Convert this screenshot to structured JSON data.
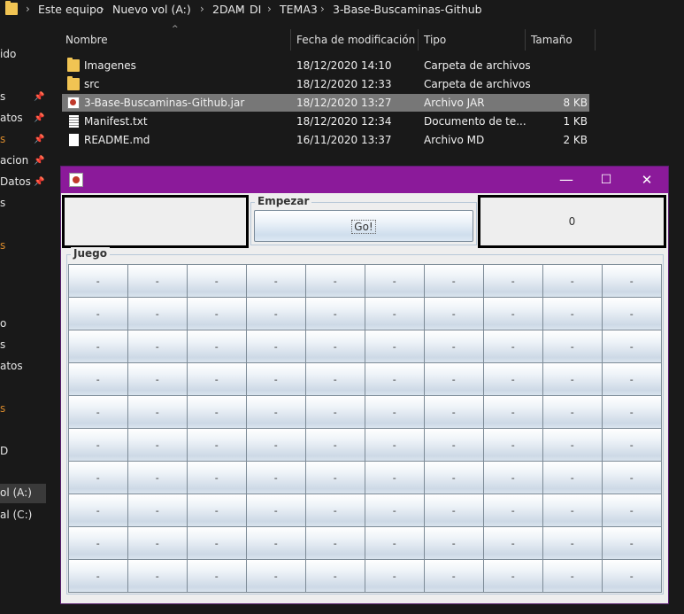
{
  "breadcrumb": [
    "Este equipo",
    "Nuevo vol (A:)",
    "2DAM",
    "DI",
    "TEMA3",
    "3-Base-Buscaminas-Github"
  ],
  "nav_pane": {
    "items": [
      {
        "label": "ido",
        "pinned": false
      },
      {
        "label": "s",
        "pinned": true
      },
      {
        "label": "atos",
        "pinned": true
      },
      {
        "label": "s",
        "pinned": true
      },
      {
        "label": "acion",
        "pinned": true
      },
      {
        "label": "Datos",
        "pinned": true
      },
      {
        "label": "s",
        "pinned": false
      },
      {
        "label": "s",
        "pinned": false
      },
      {
        "label": "o",
        "pinned": false
      },
      {
        "label": "s",
        "pinned": false
      },
      {
        "label": "atos",
        "pinned": false
      },
      {
        "label": "s",
        "pinned": false
      },
      {
        "label": "D",
        "pinned": false
      },
      {
        "label": "ol (A:)",
        "pinned": false,
        "selected": true
      },
      {
        "label": "al (C:)",
        "pinned": false
      }
    ]
  },
  "file_list": {
    "columns": [
      "Nombre",
      "Fecha de modificación",
      "Tipo",
      "Tamaño"
    ],
    "rows": [
      {
        "name": "Imagenes",
        "date": "18/12/2020 14:10",
        "type": "Carpeta de archivos",
        "size": "",
        "icon": "folder-icon"
      },
      {
        "name": "src",
        "date": "18/12/2020 12:33",
        "type": "Carpeta de archivos",
        "size": "",
        "icon": "folder-icon"
      },
      {
        "name": "3-Base-Buscaminas-Github.jar",
        "date": "18/12/2020 13:27",
        "type": "Archivo JAR",
        "size": "8 KB",
        "icon": "jar-file-icon",
        "selected": true
      },
      {
        "name": "Manifest.txt",
        "date": "18/12/2020 12:34",
        "type": "Documento de te...",
        "size": "1 KB",
        "icon": "text-file-icon"
      },
      {
        "name": "README.md",
        "date": "16/11/2020 13:37",
        "type": "Archivo MD",
        "size": "2 KB",
        "icon": "document-file-icon"
      }
    ]
  },
  "java_window": {
    "title": "",
    "title_bar_color": "#8b1a9a",
    "controls": {
      "minimize": "—",
      "maximize": "☐",
      "close": "✕"
    },
    "start_group_title": "Empezar",
    "go_button": "Go!",
    "counter_value": "0",
    "game_group_title": "Juego",
    "grid": {
      "rows": 10,
      "cols": 10,
      "cell_label": "-"
    }
  }
}
